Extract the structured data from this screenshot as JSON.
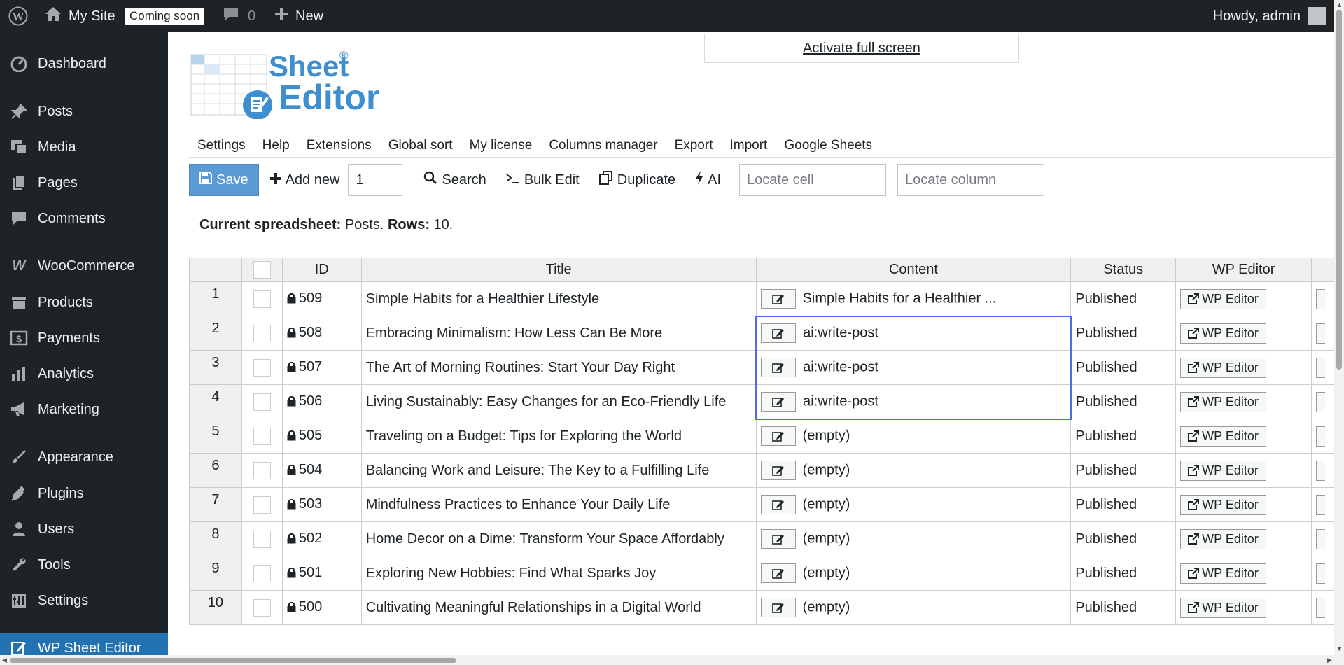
{
  "adminbar": {
    "site_name": "My Site",
    "coming_soon": "Coming soon",
    "comments_count": "0",
    "new_label": "New",
    "howdy": "Howdy, admin"
  },
  "sidebar": {
    "items": [
      {
        "label": "Dashboard",
        "icon": "dashboard-icon"
      },
      {
        "label": "Posts",
        "icon": "pin-icon"
      },
      {
        "label": "Media",
        "icon": "media-icon"
      },
      {
        "label": "Pages",
        "icon": "pages-icon"
      },
      {
        "label": "Comments",
        "icon": "comments-icon"
      },
      {
        "label": "WooCommerce",
        "icon": "woocommerce-icon"
      },
      {
        "label": "Products",
        "icon": "products-icon"
      },
      {
        "label": "Payments",
        "icon": "payments-icon"
      },
      {
        "label": "Analytics",
        "icon": "analytics-icon"
      },
      {
        "label": "Marketing",
        "icon": "megaphone-icon"
      },
      {
        "label": "Appearance",
        "icon": "brush-icon"
      },
      {
        "label": "Plugins",
        "icon": "plugin-icon"
      },
      {
        "label": "Users",
        "icon": "user-icon"
      },
      {
        "label": "Tools",
        "icon": "wrench-icon"
      },
      {
        "label": "Settings",
        "icon": "settings-icon"
      },
      {
        "label": "WP Sheet Editor",
        "icon": "sheet-editor-icon"
      }
    ]
  },
  "logo": {
    "line1": "Sheet",
    "line2": "Editor",
    "registered": "®"
  },
  "fullscreen_link": "Activate full screen",
  "menu": [
    "Settings",
    "Help",
    "Extensions",
    "Global sort",
    "My license",
    "Columns manager",
    "Export",
    "Import",
    "Google Sheets"
  ],
  "toolbar": {
    "save": "Save",
    "add_new": "Add new",
    "add_count": "1",
    "search": "Search",
    "bulk_edit": "Bulk Edit",
    "duplicate": "Duplicate",
    "ai": "AI",
    "locate_cell_placeholder": "Locate cell",
    "locate_column_placeholder": "Locate column"
  },
  "status": {
    "label1": "Current spreadsheet:",
    "value1": "Posts.",
    "label2": "Rows:",
    "value2": "10."
  },
  "grid": {
    "headers": {
      "id": "ID",
      "title": "Title",
      "content": "Content",
      "status": "Status",
      "wp_editor": "WP Editor"
    },
    "wp_editor_button": "WP Editor",
    "rows": [
      {
        "n": "1",
        "id": "509",
        "title": "Simple Habits for a Healthier Lifestyle",
        "content": "Simple Habits for a Healthier ...",
        "status": "Published"
      },
      {
        "n": "2",
        "id": "508",
        "title": "Embracing Minimalism: How Less Can Be More",
        "content": "ai:write-post",
        "status": "Published"
      },
      {
        "n": "3",
        "id": "507",
        "title": "The Art of Morning Routines: Start Your Day Right",
        "content": "ai:write-post",
        "status": "Published"
      },
      {
        "n": "4",
        "id": "506",
        "title": "Living Sustainably: Easy Changes for an Eco-Friendly Life",
        "content": "ai:write-post",
        "status": "Published"
      },
      {
        "n": "5",
        "id": "505",
        "title": "Traveling on a Budget: Tips for Exploring the World",
        "content": "(empty)",
        "status": "Published"
      },
      {
        "n": "6",
        "id": "504",
        "title": "Balancing Work and Leisure: The Key to a Fulfilling Life",
        "content": "(empty)",
        "status": "Published"
      },
      {
        "n": "7",
        "id": "503",
        "title": "Mindfulness Practices to Enhance Your Daily Life",
        "content": "(empty)",
        "status": "Published"
      },
      {
        "n": "8",
        "id": "502",
        "title": "Home Decor on a Dime: Transform Your Space Affordably",
        "content": "(empty)",
        "status": "Published"
      },
      {
        "n": "9",
        "id": "501",
        "title": "Exploring New Hobbies: Find What Sparks Joy",
        "content": "(empty)",
        "status": "Published"
      },
      {
        "n": "10",
        "id": "500",
        "title": "Cultivating Meaningful Relationships in a Digital World",
        "content": "(empty)",
        "status": "Published"
      }
    ]
  },
  "colors": {
    "adminbar": "#1d2327",
    "accent": "#2271b1",
    "save_button": "#5b9bd5",
    "selection": "#4b6ee3"
  }
}
